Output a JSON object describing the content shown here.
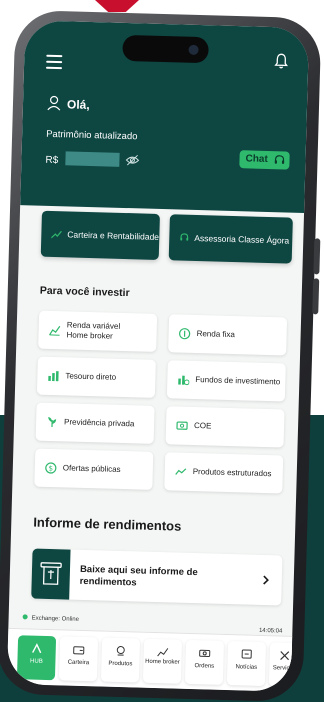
{
  "header": {
    "greeting": "Olá,",
    "patrimonio_label": "Patrimônio atualizado",
    "currency": "R$",
    "chat_label": "Chat"
  },
  "quick_actions": [
    {
      "label": "Carteira e Rentabilidade",
      "icon": "trend-icon"
    },
    {
      "label": "Assessoria Classe Ágora",
      "icon": "headset-icon"
    }
  ],
  "investir": {
    "title": "Para você investir",
    "items": [
      {
        "label": "Renda variável Home broker",
        "icon": "chart-up-icon"
      },
      {
        "label": "Renda fixa",
        "icon": "coin-icon"
      },
      {
        "label": "Tesouro direto",
        "icon": "bars-icon"
      },
      {
        "label": "Fundos de investimento",
        "icon": "bars-coin-icon"
      },
      {
        "label": "Previdência privada",
        "icon": "plant-icon"
      },
      {
        "label": "COE",
        "icon": "card-icon"
      },
      {
        "label": "Ofertas públicas",
        "icon": "dollar-icon"
      },
      {
        "label": "Produtos estruturados",
        "icon": "line-chart-icon"
      }
    ]
  },
  "informe": {
    "title": "Informe de rendimentos",
    "card_text": "Baixe aqui seu informe de rendimentos"
  },
  "status": {
    "exchange": "Exchange: Online",
    "time": "14:05:04"
  },
  "tabs": [
    {
      "label": "HUB",
      "icon": "logo-icon"
    },
    {
      "label": "Carteira",
      "icon": "wallet-icon"
    },
    {
      "label": "Produtos",
      "icon": "products-icon"
    },
    {
      "label": "Home broker",
      "icon": "home-broker-icon"
    },
    {
      "label": "Ordens",
      "icon": "orders-icon"
    },
    {
      "label": "Notícias",
      "icon": "news-icon"
    },
    {
      "label": "Serviços",
      "icon": "services-icon"
    }
  ],
  "colors": {
    "brand_dark": "#0e4642",
    "accent_green": "#2fb96d",
    "accent_red": "#c8102e"
  }
}
